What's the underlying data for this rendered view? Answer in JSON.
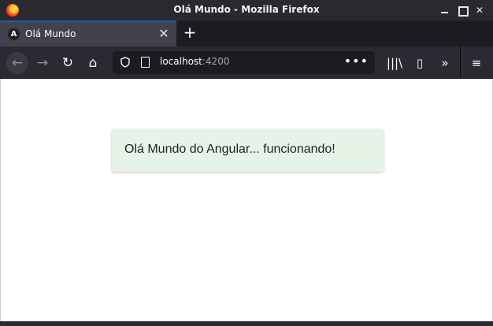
{
  "window": {
    "title": "Olá Mundo - Mozilla Firefox"
  },
  "tab": {
    "title": "Olá Mundo",
    "favicon_letter": "A",
    "close_glyph": "✕"
  },
  "new_tab_glyph": "+",
  "nav": {
    "back_glyph": "←",
    "forward_glyph": "→",
    "reload_glyph": "↻",
    "home_glyph": "⌂"
  },
  "url": {
    "host": "localhost",
    "port": ":4200",
    "actions_glyph": "•••"
  },
  "toolbar": {
    "library_glyph": "|||\\",
    "sidebar_glyph": "▯",
    "overflow_glyph": "»",
    "menu_glyph": "≡"
  },
  "page": {
    "message": "Olá Mundo do Angular... funcionando!"
  },
  "colors": {
    "accent": "#0060df",
    "alert_bg": "#e8f3e8",
    "chrome": "#2b2a33"
  }
}
